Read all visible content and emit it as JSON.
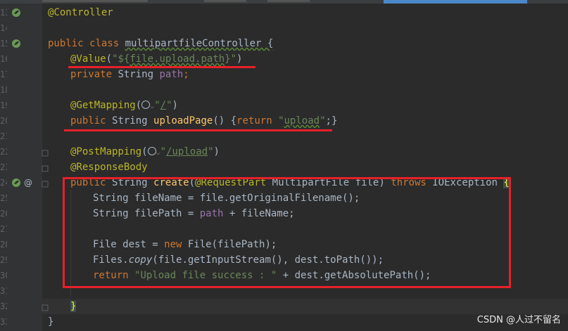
{
  "editor": {
    "line_numbers": [
      "13",
      "14",
      "15",
      "16",
      "17",
      "18",
      "19",
      "20",
      "21",
      "22",
      "23",
      "24",
      "25",
      "26",
      "27",
      "28",
      "29",
      "30",
      "31",
      "32",
      "33"
    ],
    "code": {
      "l13_annotation": "@Controller",
      "l15_public": "public",
      "l15_class": "class",
      "l15_name": "multipartfileController {",
      "l16_annotation": "@Value",
      "l16_open": "(",
      "l16_str_a": "\"${",
      "l16_str_b": "file.upload.path",
      "l16_str_c": "}\"",
      "l16_close": ")",
      "l17_private": "private",
      "l17_type": "String",
      "l17_field": "path",
      "l17_semi": ";",
      "l19_annotation": "@GetMapping",
      "l19_open": "(",
      "l19_str_a": "\"",
      "l19_url": "/",
      "l19_str_b": "\"",
      "l19_close": ")",
      "l20_public": "public",
      "l20_type": "String",
      "l20_method": "uploadPage",
      "l20_parens": "() {",
      "l20_return": "return",
      "l20_str_a": "\"",
      "l20_str_b": "upload",
      "l20_str_c": "\"",
      "l20_end": ";}",
      "l22_annotation": "@PostMapping",
      "l22_open": "(",
      "l22_str_a": "\"",
      "l22_url": "/upload",
      "l22_str_b": "\"",
      "l22_close": ")",
      "l23_annotation": "@ResponseBody",
      "l24_public": "public",
      "l24_type": "String",
      "l24_method": "create",
      "l24_open": "(",
      "l24_param_ann": "@RequestPart",
      "l24_param": "MultipartFile file)",
      "l24_throws": "throws",
      "l24_exc": "IOException",
      "l24_brace": "{",
      "l25_a": "String fileName = file.getOriginalFilename();",
      "l26_a": "String filePath = ",
      "l26_field": "path",
      "l26_b": " + fileName;",
      "l28_a": "File dest = ",
      "l28_new": "new",
      "l28_b": " File(filePath);",
      "l29_a": "Files.",
      "l29_copy": "copy",
      "l29_b": "(file.getInputStream(), dest.toPath());",
      "l30_return": "return",
      "l30_str": "\"Upload file success : \"",
      "l30_b": " + dest.getAbsolutePath();",
      "l32_brace": "}",
      "l33_brace": "}"
    }
  },
  "gutter_icons": [
    "spring-bean-icon",
    "spring-bean-icon",
    "spring-bean-icon",
    "override-at-icon"
  ],
  "watermark": "CSDN @人过不留名",
  "colors": {
    "annotation": "#bbb529",
    "keyword": "#cc7832",
    "string": "#6a8759",
    "field": "#9876aa",
    "method": "#ffc66d",
    "highlight": "#e8202a"
  }
}
